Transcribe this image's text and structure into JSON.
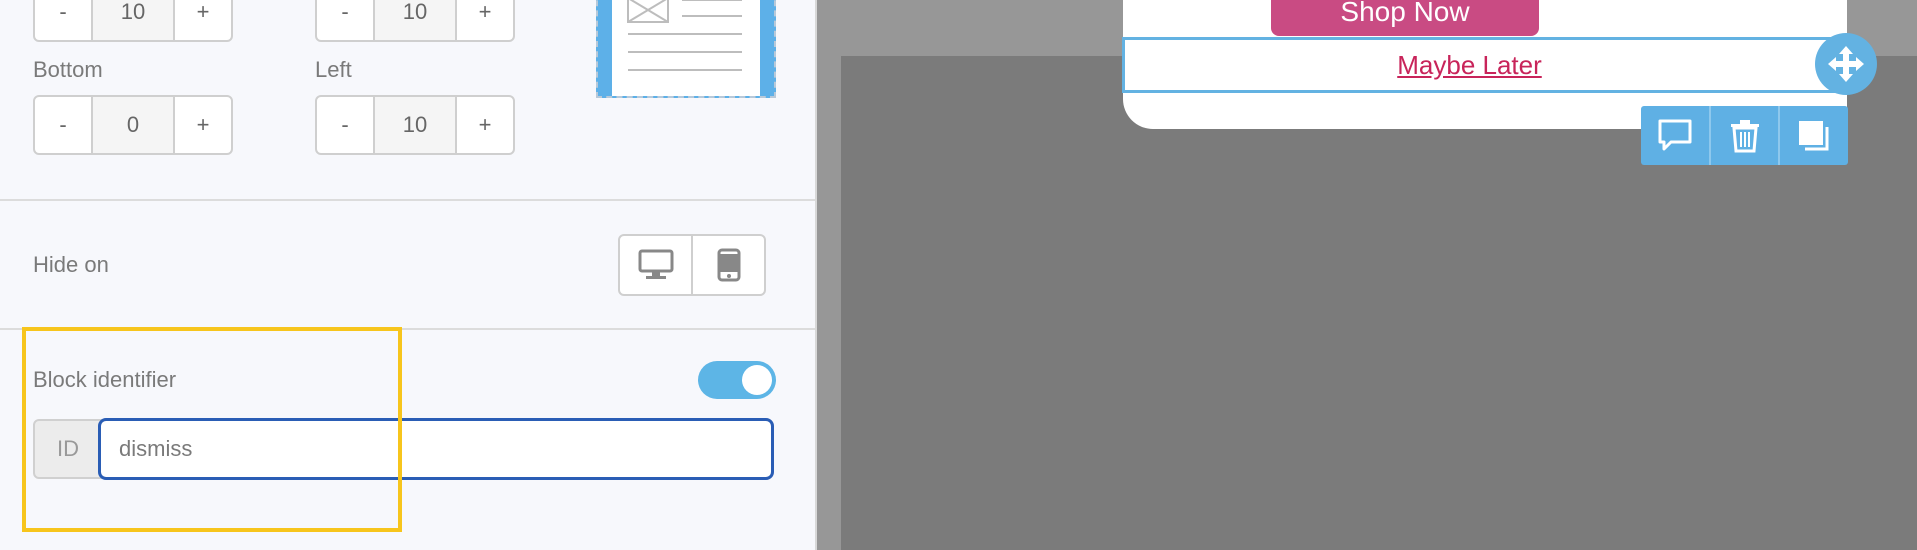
{
  "padding": {
    "top_minus": "-",
    "top_value": "10",
    "top_plus": "+",
    "right_minus": "-",
    "right_value": "10",
    "right_plus": "+",
    "bottom_label": "Bottom",
    "bottom_minus": "-",
    "bottom_value": "0",
    "bottom_plus": "+",
    "left_label": "Left",
    "left_minus": "-",
    "left_value": "10",
    "left_plus": "+"
  },
  "hide_on": {
    "label": "Hide on",
    "icons": [
      "desktop-icon",
      "mobile-icon"
    ]
  },
  "block_identifier": {
    "label": "Block identifier",
    "toggle_on": true,
    "prefix": "ID",
    "value": "dismiss"
  },
  "canvas": {
    "shop_button_label": "Shop Now",
    "maybe_later_label": "Maybe Later",
    "toolbar_icons": [
      "comment-icon",
      "trash-icon",
      "duplicate-icon"
    ],
    "move_icon": "move-icon"
  },
  "colors": {
    "accent_blue": "#63b2e2",
    "input_focus": "#2a5db5",
    "highlight_yellow": "#f7c51c",
    "shop_pink": "#c94b83",
    "link_red": "#c8245a"
  }
}
